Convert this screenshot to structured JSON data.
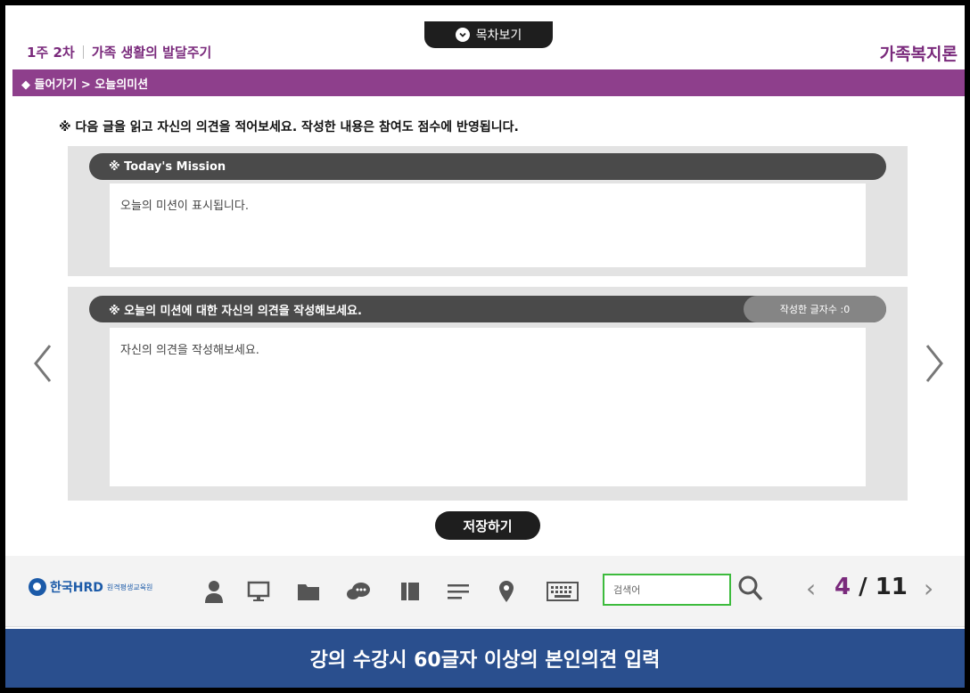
{
  "header": {
    "toc_label": "목차보기",
    "week": "1주 2차",
    "chapter": "가족 생활의 발달주기",
    "course_title": "가족복지론",
    "breadcrumb": "◆ 들어가기 > 오늘의미션"
  },
  "instruction": "※ 다음 글을 읽고 자신의 의견을 적어보세요. 작성한 내용은 참여도 점수에 반영됩니다.",
  "mission": {
    "title": "※ Today's Mission",
    "content": "오늘의 미션이 표시됩니다."
  },
  "opinion": {
    "title": "※ 오늘의 미션에 대한 자신의 의견을 작성해보세요.",
    "char_count": "작성한 글자수 :0",
    "placeholder": "자신의 의견을 작성해보세요."
  },
  "save_label": "저장하기",
  "nav": {
    "prev": "‹",
    "next": "›"
  },
  "toolbar": {
    "logo_name": "한국HRD",
    "logo_sub": "원격평생교육원",
    "search_placeholder": "검색어",
    "page_prev": "‹",
    "page_current": "4",
    "page_sep": " / ",
    "page_total": "11",
    "page_next": "›",
    "icons": [
      "user-icon",
      "monitor-icon",
      "folder-icon",
      "chat-icon",
      "book-icon",
      "menu-lines-icon",
      "location-pin-icon",
      "keyboard-icon",
      "search-icon"
    ]
  },
  "caption": "강의 수강시 60글자 이상의 본인의견 입력",
  "colors": {
    "brand_purple": "#8e3f8c",
    "caption_blue": "#2a4f8e",
    "search_border": "#3dbb3d"
  }
}
